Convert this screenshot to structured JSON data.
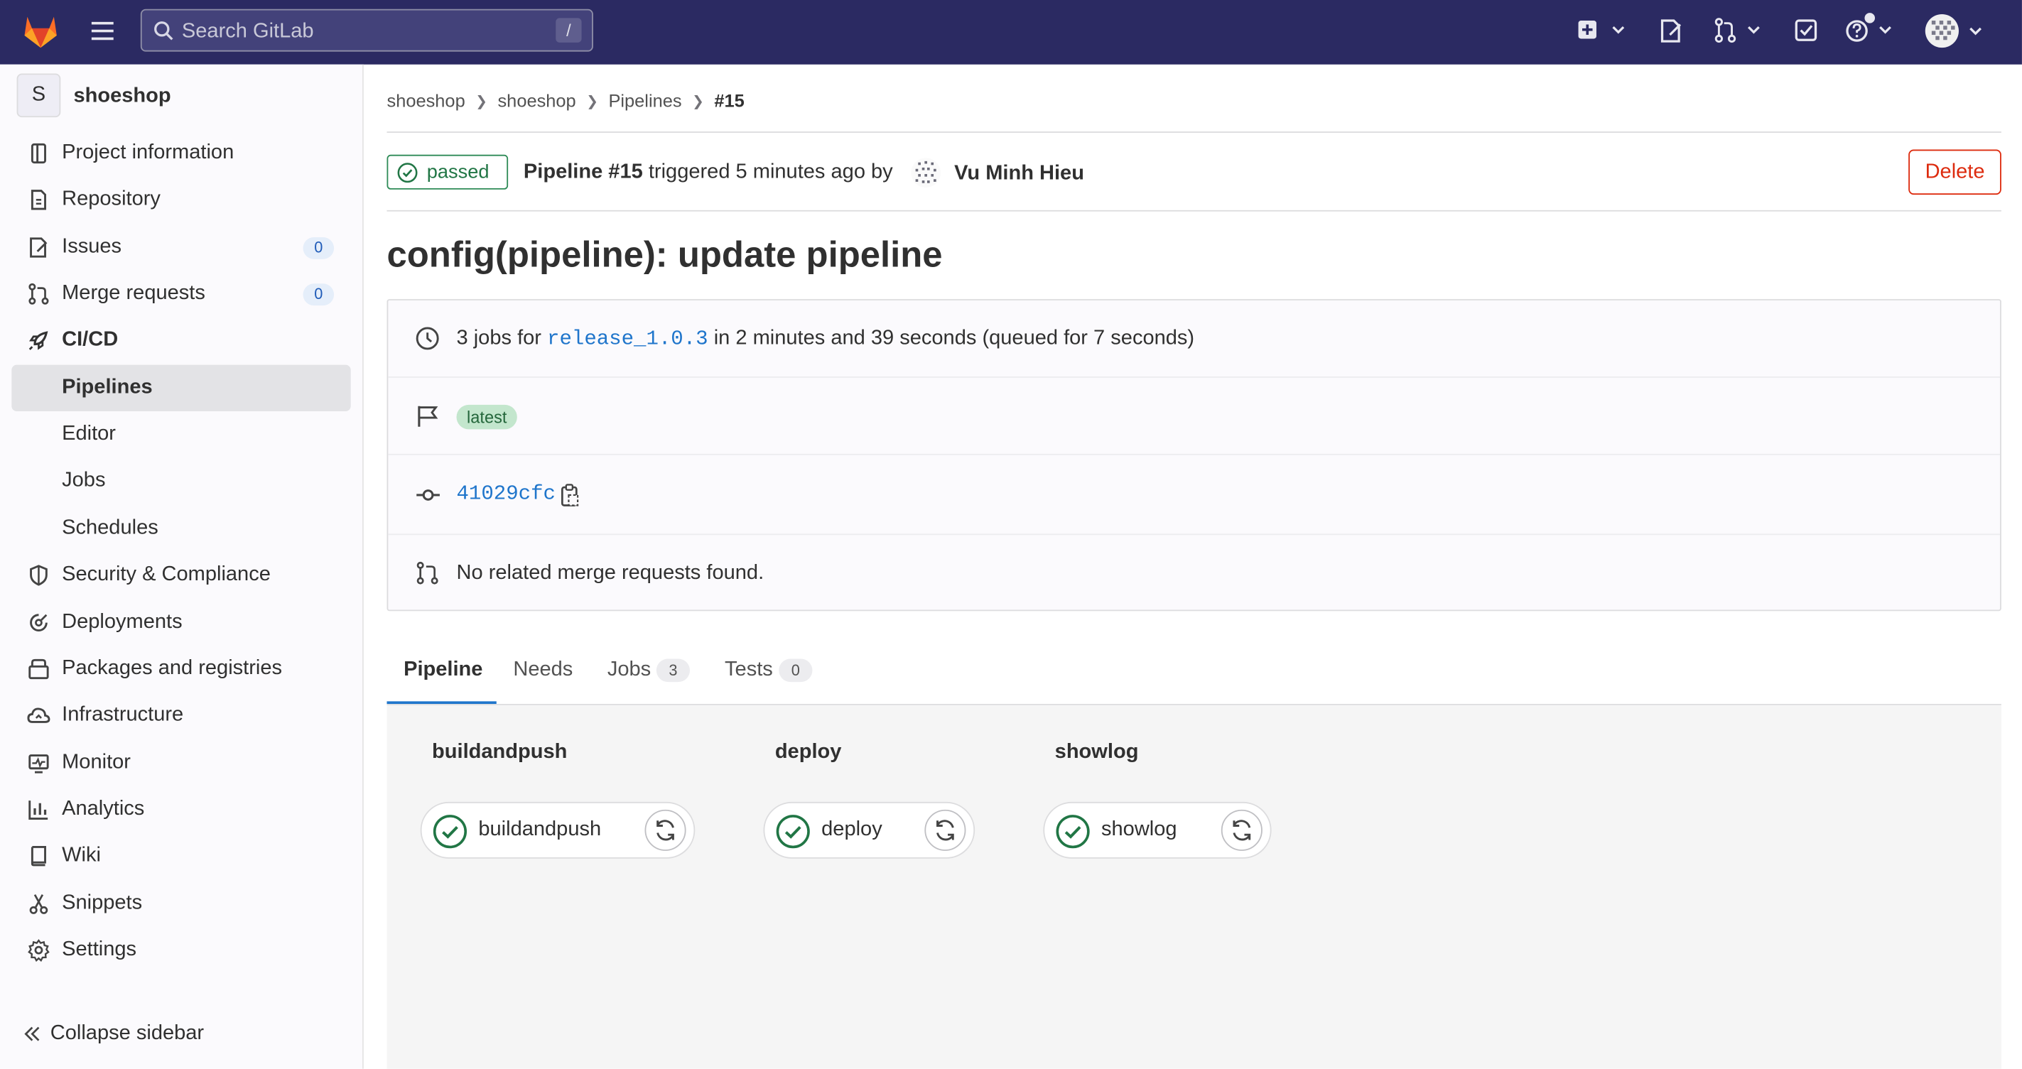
{
  "search": {
    "placeholder": "Search GitLab",
    "shortcut": "/"
  },
  "sidebar": {
    "project_initial": "S",
    "project_name": "shoeshop",
    "items": [
      {
        "label": "Project information",
        "icon": "project-icon"
      },
      {
        "label": "Repository",
        "icon": "document-icon"
      },
      {
        "label": "Issues",
        "icon": "issues-icon",
        "count": "0"
      },
      {
        "label": "Merge requests",
        "icon": "merge-request-icon",
        "count": "0"
      },
      {
        "label": "CI/CD",
        "icon": "rocket-icon"
      },
      {
        "label": "Pipelines"
      },
      {
        "label": "Editor"
      },
      {
        "label": "Jobs"
      },
      {
        "label": "Schedules"
      },
      {
        "label": "Security & Compliance",
        "icon": "shield-icon"
      },
      {
        "label": "Deployments",
        "icon": "deployments-icon"
      },
      {
        "label": "Packages and registries",
        "icon": "package-icon"
      },
      {
        "label": "Infrastructure",
        "icon": "cloud-icon"
      },
      {
        "label": "Monitor",
        "icon": "monitor-icon"
      },
      {
        "label": "Analytics",
        "icon": "chart-icon"
      },
      {
        "label": "Wiki",
        "icon": "book-icon"
      },
      {
        "label": "Snippets",
        "icon": "scissors-icon"
      },
      {
        "label": "Settings",
        "icon": "gear-icon"
      }
    ],
    "collapse_label": "Collapse sidebar"
  },
  "breadcrumb": [
    "shoeshop",
    "shoeshop",
    "Pipelines",
    "#15"
  ],
  "pipeline": {
    "status": "passed",
    "title_strong": "Pipeline #15",
    "triggered_text": "triggered 5 minutes ago by",
    "author": "Vu Minh Hieu",
    "delete_label": "Delete",
    "commit_title": "config(pipeline): update pipeline"
  },
  "info": {
    "jobs_prefix": "3 jobs for",
    "branch": "release_1.0.3",
    "jobs_suffix": "in 2 minutes and 39 seconds (queued for 7 seconds)",
    "badge": "latest",
    "commit_sha": "41029cfc",
    "merge_requests": "No related merge requests found."
  },
  "tabs": [
    {
      "label": "Pipeline"
    },
    {
      "label": "Needs"
    },
    {
      "label": "Jobs",
      "count": "3"
    },
    {
      "label": "Tests",
      "count": "0"
    }
  ],
  "stages": [
    {
      "name": "buildandpush",
      "job": "buildandpush"
    },
    {
      "name": "deploy",
      "job": "deploy"
    },
    {
      "name": "showlog",
      "job": "showlog"
    }
  ],
  "colors": {
    "topbar": "#2b2a62",
    "success": "#217645",
    "link": "#1f75cb",
    "danger": "#dd2b0e"
  }
}
